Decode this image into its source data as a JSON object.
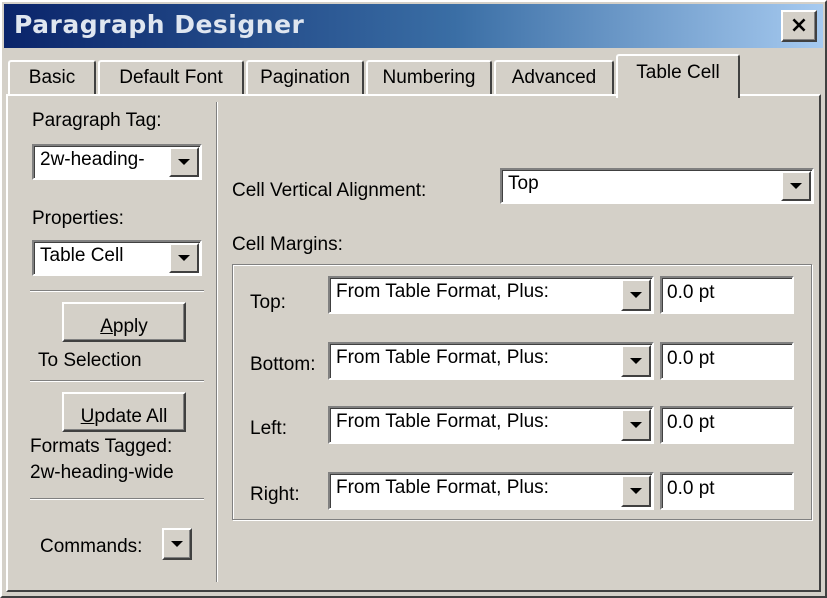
{
  "window": {
    "title": "Paragraph Designer",
    "close_label": "×"
  },
  "tabs": [
    {
      "label": "Basic",
      "active": false
    },
    {
      "label": "Default Font",
      "active": false
    },
    {
      "label": "Pagination",
      "active": false
    },
    {
      "label": "Numbering",
      "active": false
    },
    {
      "label": "Advanced",
      "active": false
    },
    {
      "label": "Table Cell",
      "active": true
    }
  ],
  "left_panel": {
    "paragraph_tag_label": "Paragraph Tag:",
    "paragraph_tag_value": "2w-heading-",
    "properties_label": "Properties:",
    "properties_value": "Table Cell",
    "apply_button": {
      "underlined_char": "A",
      "rest": "pply"
    },
    "apply_caption": "To Selection",
    "update_all_button": {
      "underlined_char": "U",
      "rest": "pdate All"
    },
    "formats_tagged_label": "Formats Tagged:",
    "formats_tagged_value": "2w-heading-wide",
    "commands_label": "Commands:"
  },
  "table_cell": {
    "vertical_alignment_label": "Cell Vertical Alignment:",
    "vertical_alignment_value": "Top",
    "margins_label": "Cell Margins:",
    "margins": [
      {
        "label": "Top:",
        "mode": "From Table Format, Plus:",
        "value": "0.0 pt"
      },
      {
        "label": "Bottom:",
        "mode": "From Table Format, Plus:",
        "value": "0.0 pt"
      },
      {
        "label": "Left:",
        "mode": "From Table Format, Plus:",
        "value": "0.0 pt"
      },
      {
        "label": "Right:",
        "mode": "From Table Format, Plus:",
        "value": "0.0 pt"
      }
    ]
  },
  "colors": {
    "face": "#d4d0c8",
    "title_gradient_start": "#0a246a",
    "title_gradient_end": "#a6caf0"
  }
}
